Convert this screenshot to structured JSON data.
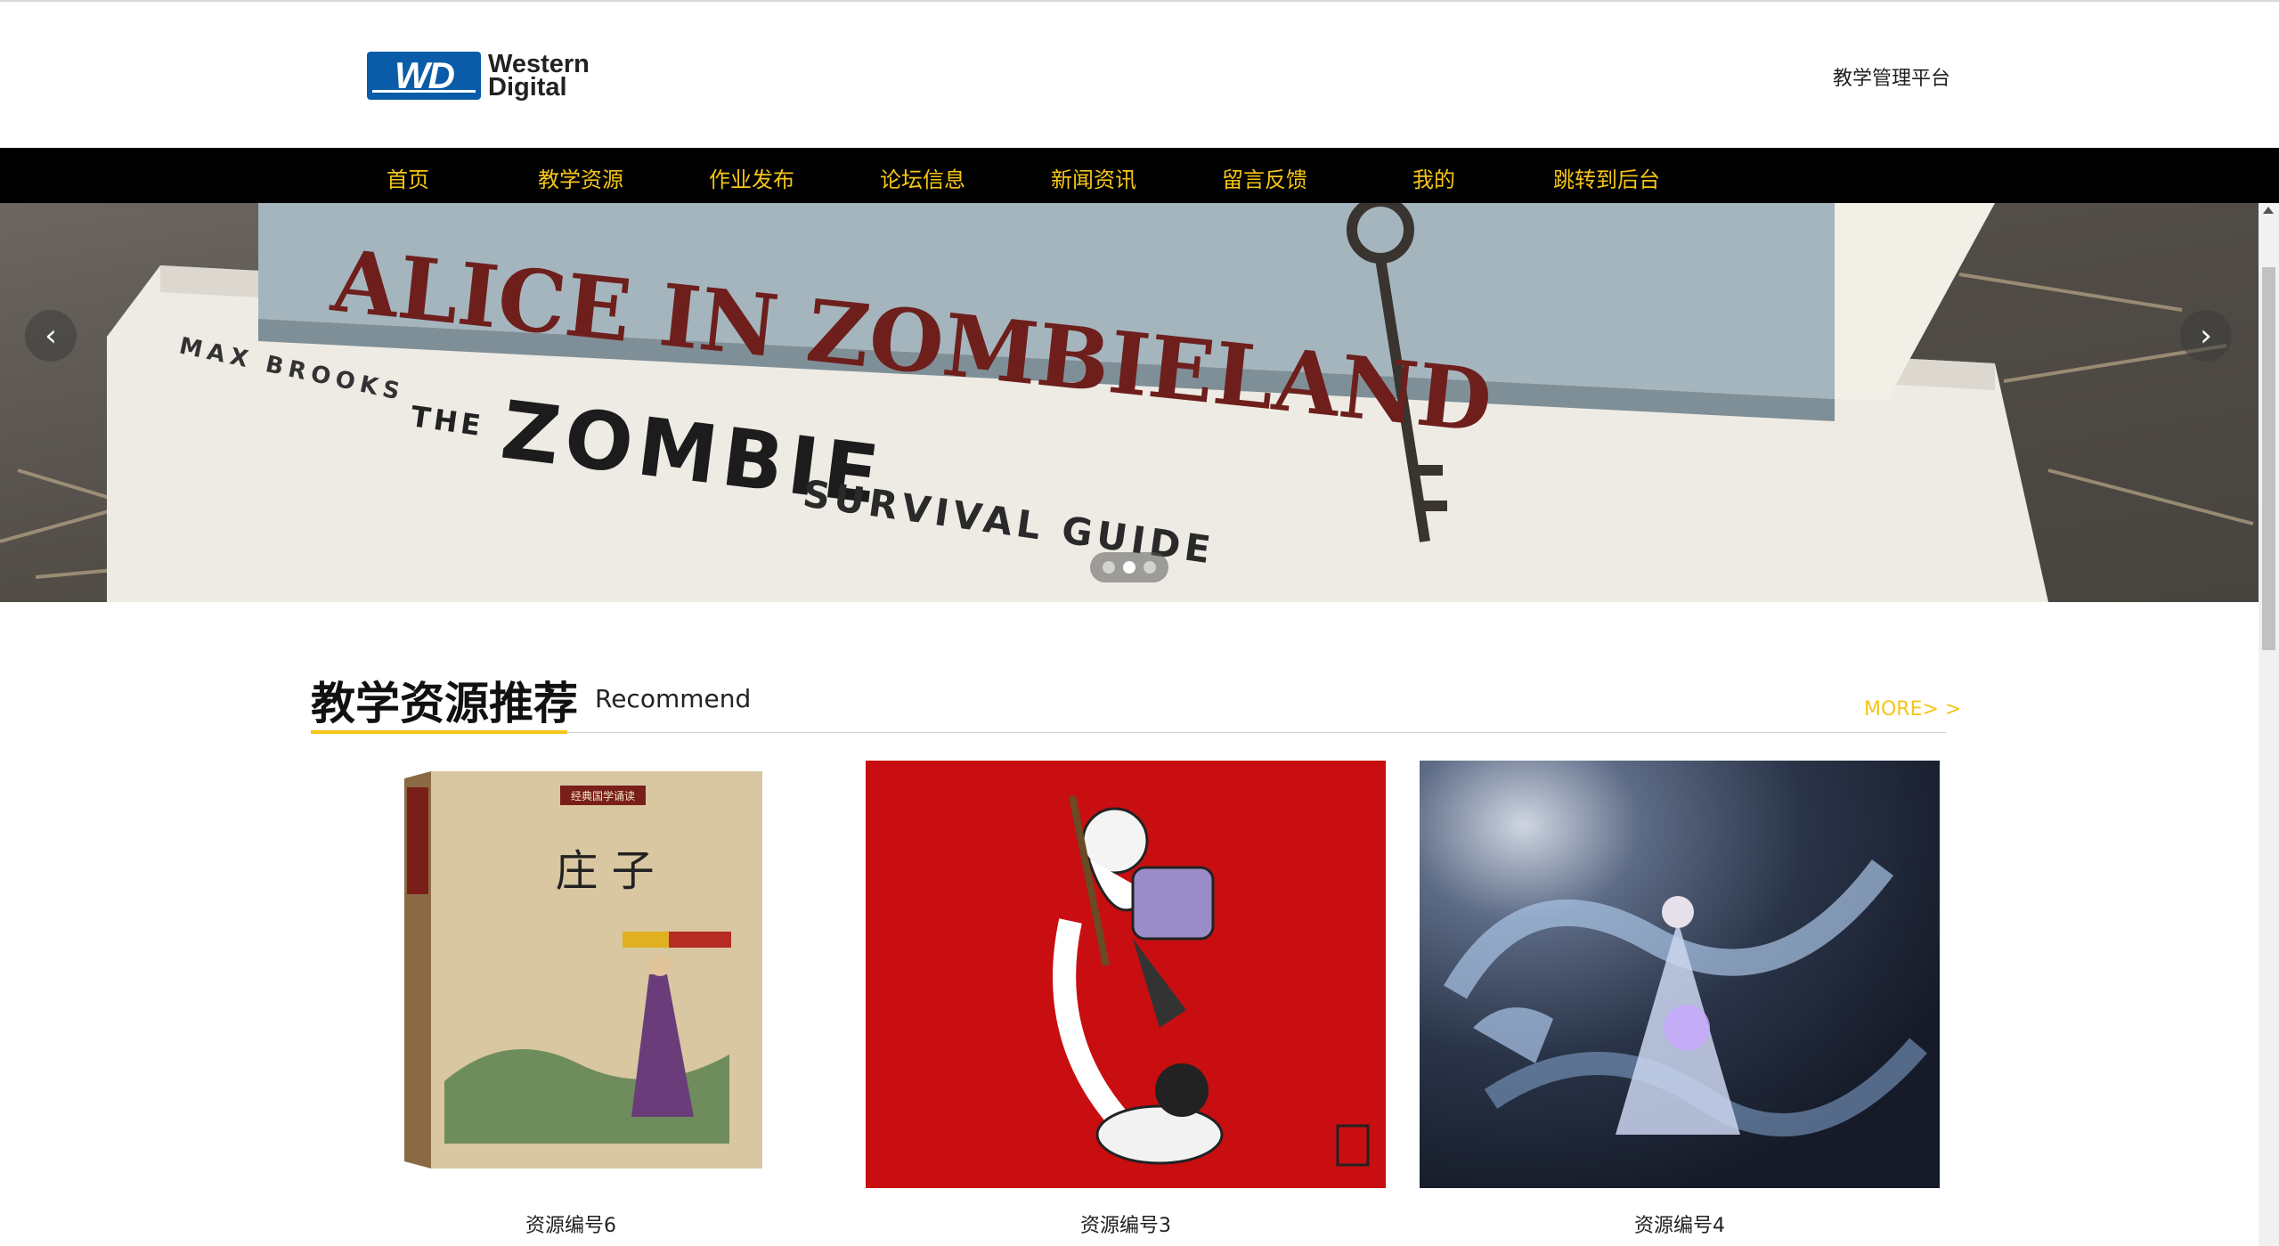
{
  "header": {
    "logo_line1": "Western",
    "logo_line2": "Digital",
    "logo_mark": "WD",
    "platform_link": "教学管理平台"
  },
  "nav": {
    "items": [
      "首页",
      "教学资源",
      "作业发布",
      "论坛信息",
      "新闻资讯",
      "留言反馈",
      "我的",
      "跳转到后台"
    ]
  },
  "banner": {
    "book1_title": "ALICE IN ZOMBIELAND",
    "book2_author": "MAX BROOKS",
    "book2_the": "THE",
    "book2_title": "ZOMBIE",
    "book2_subtitle": "SURVIVAL GUIDE",
    "prev_icon": "chevron-left-icon",
    "next_icon": "chevron-right-icon",
    "slide_count": 3,
    "active_slide": 2
  },
  "section": {
    "title": "教学资源推荐",
    "subtitle": "Recommend",
    "more": "MORE> >"
  },
  "cards": [
    {
      "label": "资源编号6",
      "cover_title": "庄 子",
      "cover_series": "经典国学诵读"
    },
    {
      "label": "资源编号3"
    },
    {
      "label": "资源编号4"
    }
  ],
  "colors": {
    "accent": "#f5c518",
    "nav_bg": "#000000",
    "logo_blue": "#0a5ca8"
  }
}
